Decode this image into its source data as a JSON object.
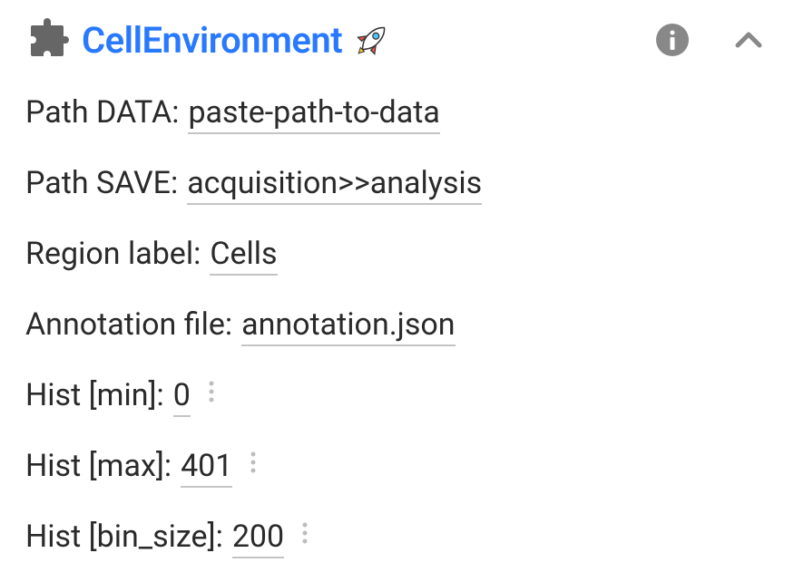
{
  "header": {
    "title": "CellEnvironment"
  },
  "fields": {
    "path_data": {
      "label": "Path DATA:",
      "value": "paste-path-to-data"
    },
    "path_save": {
      "label": "Path SAVE:",
      "value": "acquisition>>analysis"
    },
    "region_label": {
      "label": "Region label:",
      "value": "Cells"
    },
    "annotation_file": {
      "label": "Annotation file:",
      "value": "annotation.json"
    },
    "hist_min": {
      "label": "Hist [min]:",
      "value": "0"
    },
    "hist_max": {
      "label": "Hist [max]:",
      "value": "401"
    },
    "hist_bin_size": {
      "label": "Hist [bin_size]:",
      "value": "200"
    }
  }
}
